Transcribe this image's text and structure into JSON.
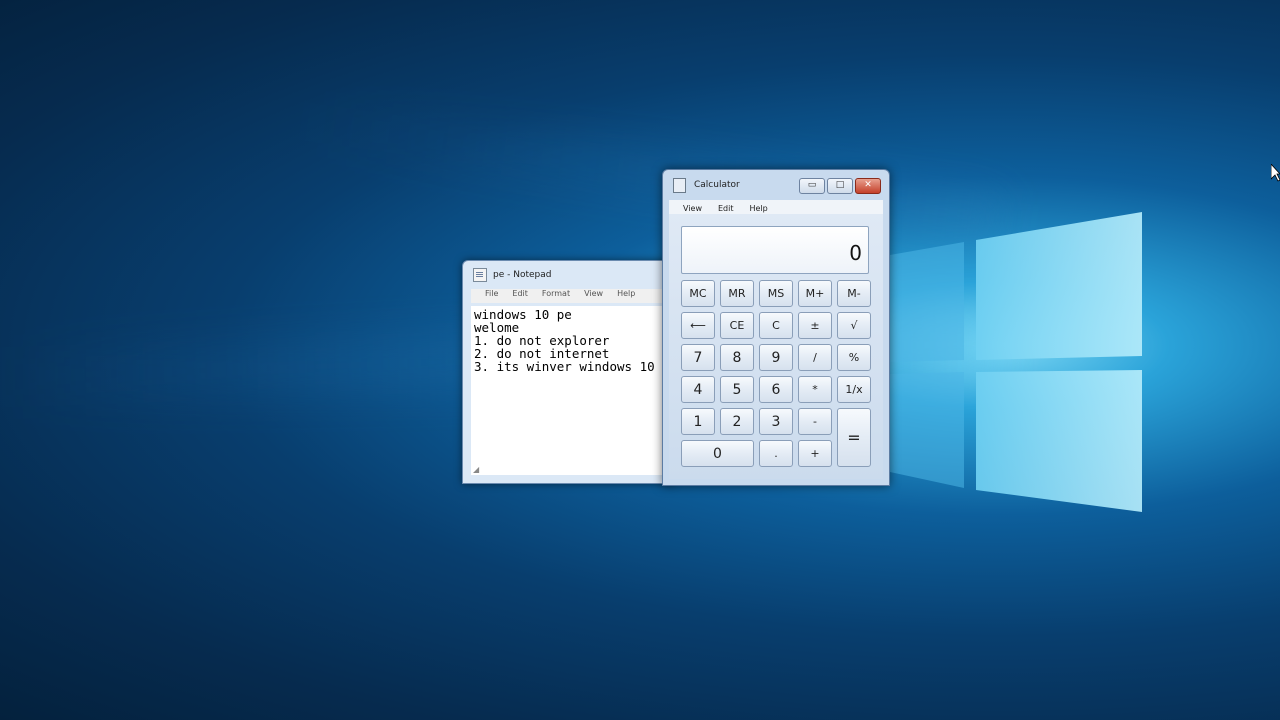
{
  "notepad": {
    "title": "pe - Notepad",
    "menu": [
      "File",
      "Edit",
      "Format",
      "View",
      "Help"
    ],
    "content": "windows 10 pe\nwelome\n1. do not explorer\n2. do not internet\n3. its winver windows 10"
  },
  "calculator": {
    "title": "Calculator",
    "menu": [
      "View",
      "Edit",
      "Help"
    ],
    "display": "0",
    "keys": {
      "mc": "MC",
      "mr": "MR",
      "ms": "MS",
      "mplus": "M+",
      "mminus": "M-",
      "back": "⟵",
      "ce": "CE",
      "c": "C",
      "plusminus": "±",
      "sqrt": "√",
      "d7": "7",
      "d8": "8",
      "d9": "9",
      "div": "/",
      "pct": "%",
      "d4": "4",
      "d5": "5",
      "d6": "6",
      "mul": "*",
      "recip": "1/x",
      "d1": "1",
      "d2": "2",
      "d3": "3",
      "sub": "-",
      "eq": "=",
      "d0": "0",
      "dot": ".",
      "add": "+"
    }
  }
}
